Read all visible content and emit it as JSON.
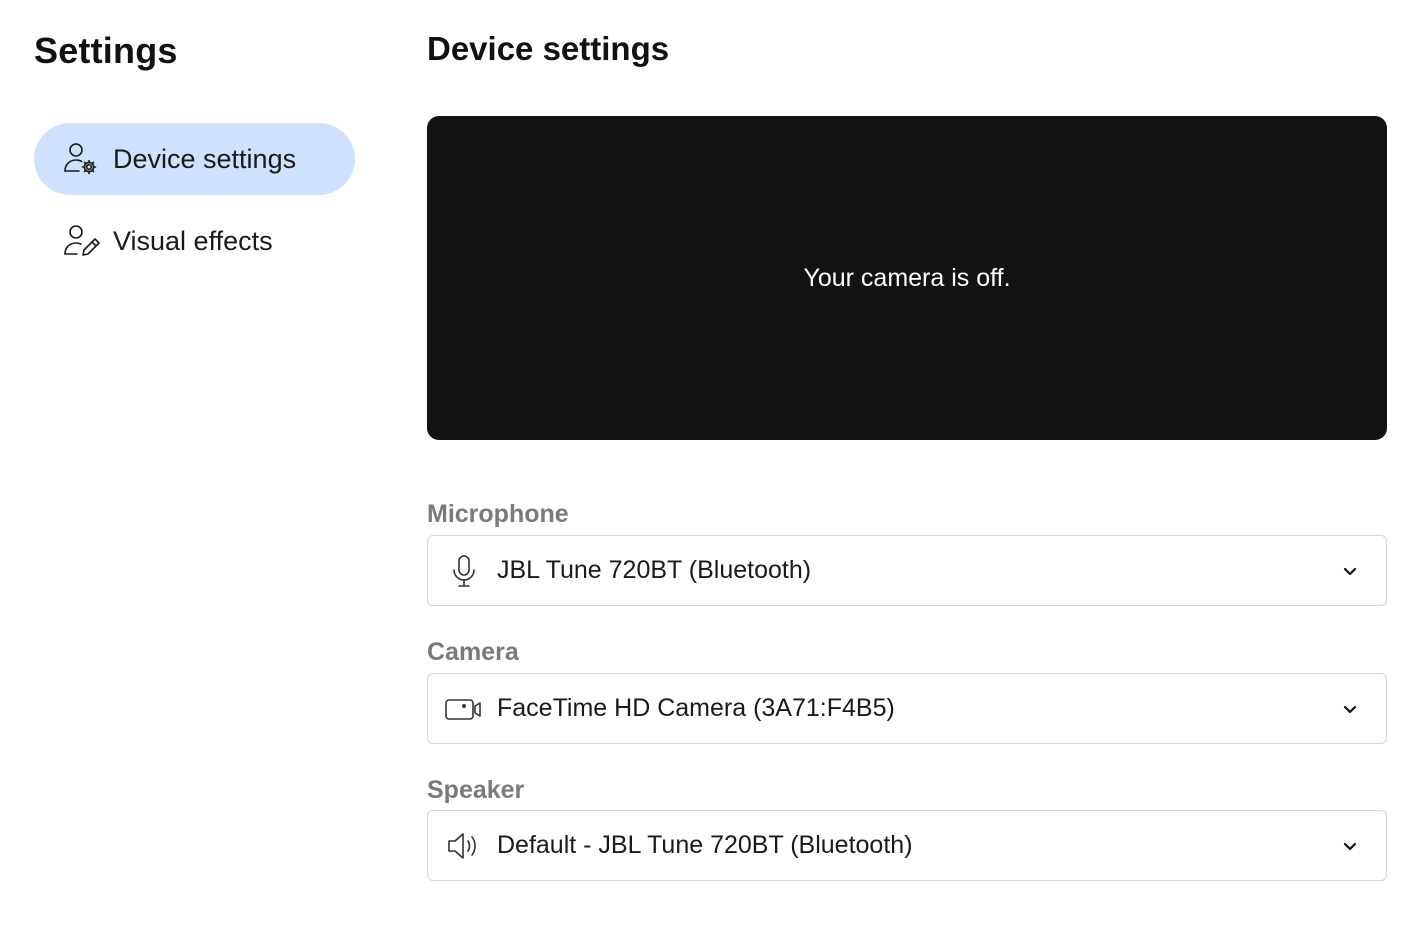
{
  "sidebar": {
    "title": "Settings",
    "items": [
      {
        "label": "Device settings",
        "icon": "person-gear-icon",
        "active": true
      },
      {
        "label": "Visual effects",
        "icon": "person-pen-icon",
        "active": false
      }
    ]
  },
  "main": {
    "title": "Device settings",
    "preview": {
      "message": "Your camera is off."
    },
    "microphone": {
      "label": "Microphone",
      "value": "JBL Tune 720BT (Bluetooth)",
      "icon": "microphone-icon"
    },
    "camera": {
      "label": "Camera",
      "value": "FaceTime HD Camera (3A71:F4B5)",
      "icon": "video-camera-icon"
    },
    "speaker": {
      "label": "Speaker",
      "value": "Default - JBL Tune 720BT (Bluetooth)",
      "icon": "speaker-icon"
    }
  },
  "colors": {
    "active_nav_bg": "#cfe2fd",
    "preview_bg": "#121212",
    "field_label": "#7a7a7a",
    "select_border": "#d6d6d6"
  }
}
